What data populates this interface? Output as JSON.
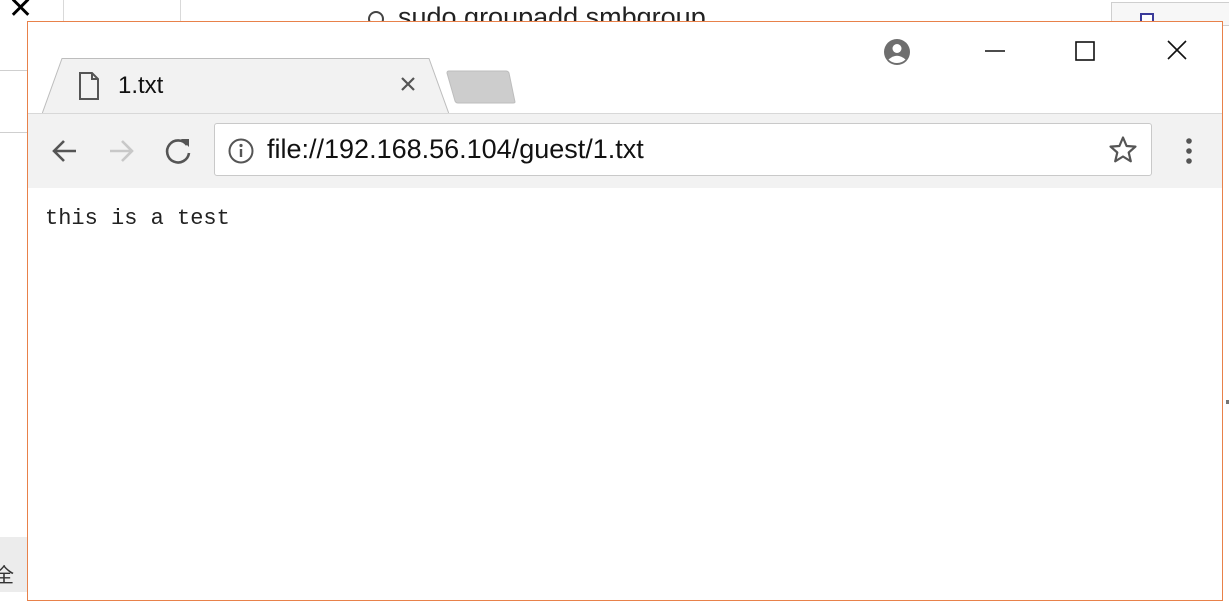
{
  "background_window": {
    "command_text": "sudo groupadd smbgroup",
    "side_label": "全"
  },
  "browser": {
    "tab": {
      "title": "1.txt"
    },
    "address_bar": {
      "url": "file://192.168.56.104/guest/1.txt"
    },
    "page": {
      "text": "this is a test"
    },
    "colors": {
      "window_border": "#e8814a",
      "chrome_bg": "#f2f2f2"
    },
    "icons": {
      "tab": "file-icon",
      "tab_close": "close-icon",
      "profile": "profile-icon",
      "back": "back-arrow-icon",
      "forward": "forward-arrow-icon",
      "reload": "reload-icon",
      "site_info": "info-icon",
      "bookmark": "star-icon",
      "menu": "menu-dots-icon"
    }
  }
}
